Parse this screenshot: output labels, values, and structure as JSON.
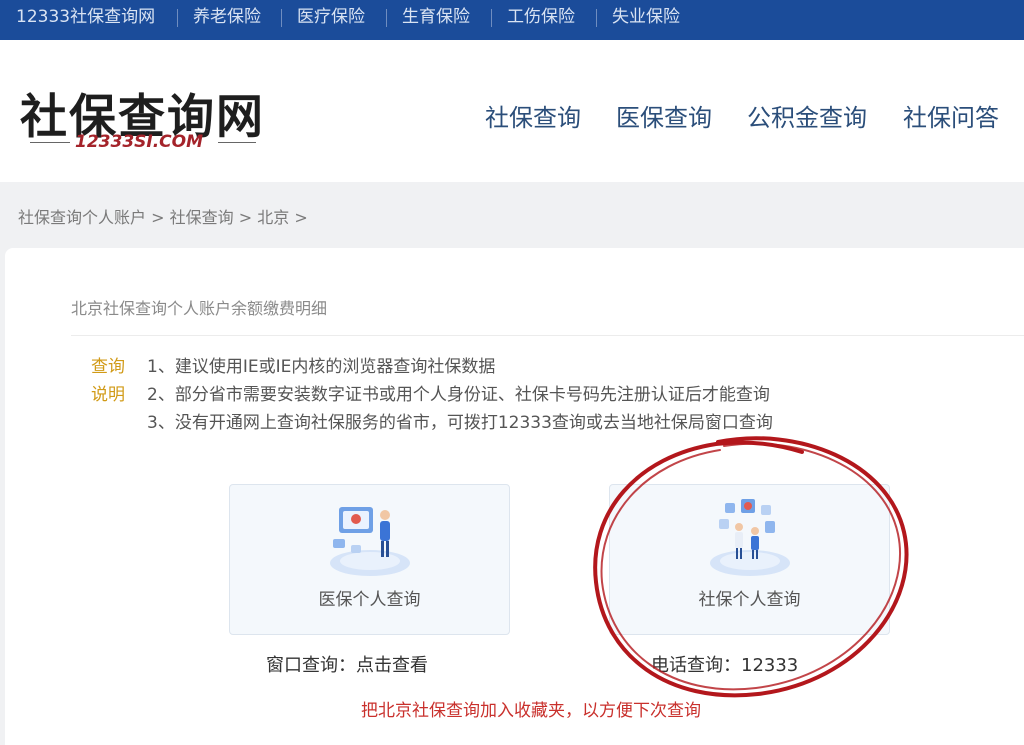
{
  "topbar": {
    "links": [
      "12333社保查询网",
      "养老保险",
      "医疗保险",
      "生育保险",
      "工伤保险",
      "失业保险"
    ]
  },
  "header": {
    "logo_title": "社保查询网",
    "logo_subtitle": "12333SI.COM",
    "nav": [
      "社保查询",
      "医保查询",
      "公积金查询",
      "社保问答"
    ]
  },
  "breadcrumb": {
    "items": [
      "社保查询个人账户",
      ">",
      "社保查询",
      ">",
      "北京",
      ">"
    ]
  },
  "content": {
    "heading": "北京社保查询个人账户余额缴费明细",
    "notice_label_line1": "查询",
    "notice_label_line2": "说明",
    "notice_lines": [
      "1、建议使用IE或IE内核的浏览器查询社保数据",
      "2、部分省市需要安装数字证书或用个人身份证、社保卡号码先注册认证后才能查询",
      "3、没有开通网上查询社保服务的省市，可拨打12333查询或去当地社保局窗口查询"
    ],
    "cards": [
      {
        "label": "医保个人查询"
      },
      {
        "label": "社保个人查询"
      }
    ],
    "window_query": "窗口查询：点击查看",
    "phone_query": "电话查询：12333",
    "favorite": "把北京社保查询加入收藏夹，以方便下次查询"
  },
  "colors": {
    "topbar": "#1b4c9a",
    "nav_text": "#2b4e7a",
    "notice_label": "#d19a16",
    "favorite_text": "#c9302c",
    "annotation_circle": "#b3171c"
  }
}
